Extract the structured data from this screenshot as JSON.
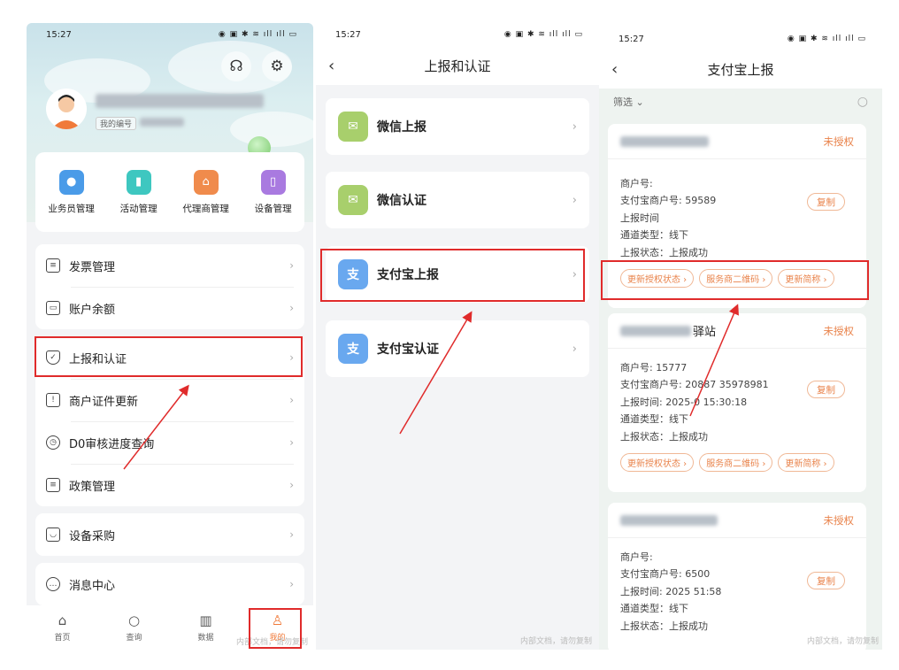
{
  "s1": {
    "time": "15:27",
    "badge": "我的编号",
    "grid": [
      {
        "label": "业务员管理",
        "color": "#4a9be8"
      },
      {
        "label": "活动管理",
        "color": "#3ec7c0"
      },
      {
        "label": "代理商管理",
        "color": "#f08b4c"
      },
      {
        "label": "设备管理",
        "color": "#a97ae0"
      }
    ],
    "menu1": [
      "发票管理",
      "账户余额"
    ],
    "menu2": [
      "上报和认证",
      "商户证件更新",
      "D0审核进度查询",
      "政策管理"
    ],
    "menu3": [
      "设备采购"
    ],
    "menu4": [
      "消息中心"
    ],
    "tabs": [
      "首页",
      "查询",
      "数据",
      "我的"
    ],
    "watermark": "内部文档，请勿复制"
  },
  "s2": {
    "time": "15:27",
    "title": "上报和认证",
    "items": [
      {
        "label": "微信上报",
        "color": "#a8cf6c"
      },
      {
        "label": "微信认证",
        "color": "#a8cf6c"
      },
      {
        "label": "支付宝上报",
        "color": "#69a8ef"
      },
      {
        "label": "支付宝认证",
        "color": "#69a8ef"
      }
    ],
    "watermark": "内部文档，请勿复制"
  },
  "s3": {
    "time": "15:27",
    "title": "支付宝上报",
    "filter": "筛选",
    "status": "未授权",
    "copy": "复制",
    "buttons": [
      "更新授权状态 ›",
      "服务商二维码 ›",
      "更新简称 ›"
    ],
    "cards": [
      {
        "title_tail": "",
        "lines": [
          "商户号:",
          "支付宝商户号:        59589",
          "上报时间",
          "通道类型：线下",
          "上报状态：上报成功"
        ]
      },
      {
        "title_tail": "驿站",
        "lines": [
          "商户号:        15777",
          "支付宝商户号: 20887      35978981",
          "上报时间: 2025-0      15:30:18",
          "通道类型：线下",
          "上报状态：上报成功"
        ]
      },
      {
        "title_tail": "",
        "lines": [
          "商户号:",
          "支付宝商户号:              6500",
          "上报时间: 2025     51:58",
          "通道类型：线下",
          "上报状态：上报成功"
        ]
      }
    ],
    "watermark": "内部文档，请勿复制"
  }
}
